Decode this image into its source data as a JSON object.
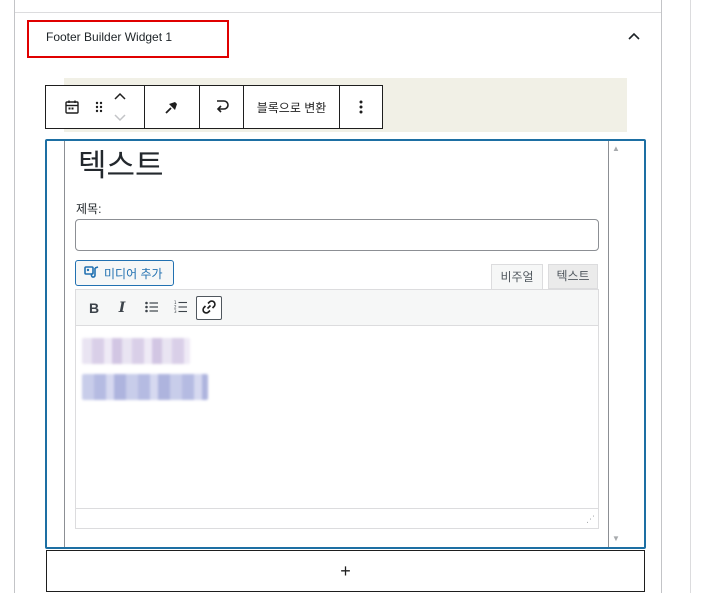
{
  "widget": {
    "title": "Footer Builder Widget 1",
    "collapse_glyph": "⌃"
  },
  "toolbar": {
    "block_icon": "calendar-icon",
    "drag_icon": "drag-handle-icon",
    "move_up_icon": "chevron-up-icon",
    "move_down_icon": "chevron-down-icon",
    "pin_icon": "pin-icon",
    "transform_icon": "transform-icon",
    "convert_label": "블록으로 변환",
    "more_icon": "more-vertical-icon"
  },
  "editor": {
    "heading": "텍스트",
    "title_label": "제목:",
    "title_value": "",
    "add_media_label": "미디어 추가",
    "tabs": [
      {
        "label": "비주얼",
        "active": true
      },
      {
        "label": "텍스트",
        "active": false
      }
    ],
    "format_buttons": [
      "B",
      "I"
    ],
    "content_redacted": true
  },
  "add_block_glyph": "+",
  "colors": {
    "accent_blue": "#2271b1",
    "highlight_red": "#e00000",
    "beige": "#f1f0e6",
    "frame_blue": "#1d6fa3"
  }
}
